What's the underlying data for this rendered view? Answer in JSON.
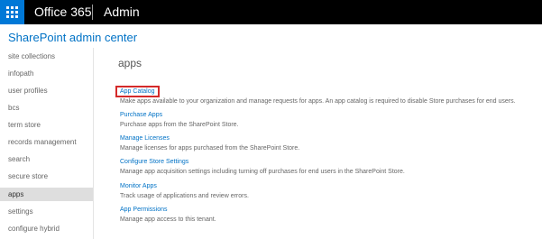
{
  "header": {
    "waffle_icon": "app-launcher-icon",
    "brand": "Office 365",
    "app": "Admin"
  },
  "center_title": "SharePoint admin center",
  "nav": {
    "items": [
      {
        "label": "site collections"
      },
      {
        "label": "infopath"
      },
      {
        "label": "user profiles"
      },
      {
        "label": "bcs"
      },
      {
        "label": "term store"
      },
      {
        "label": "records management"
      },
      {
        "label": "search"
      },
      {
        "label": "secure store"
      },
      {
        "label": "apps",
        "selected": true
      },
      {
        "label": "settings"
      },
      {
        "label": "configure hybrid"
      }
    ]
  },
  "main": {
    "title": "apps",
    "entries": [
      {
        "link": "App Catalog",
        "desc": "Make apps available to your organization and manage requests for apps. An app catalog is required to disable Store purchases for end users.",
        "highlighted": true
      },
      {
        "link": "Purchase Apps",
        "desc": "Purchase apps from the SharePoint Store."
      },
      {
        "link": "Manage Licenses",
        "desc": "Manage licenses for apps purchased from the SharePoint Store."
      },
      {
        "link": "Configure Store Settings",
        "desc": "Manage app acquisition settings including turning off purchases for end users in the SharePoint Store."
      },
      {
        "link": "Monitor Apps",
        "desc": "Track usage of applications and review errors."
      },
      {
        "link": "App Permissions",
        "desc": "Manage app access to this tenant."
      }
    ]
  },
  "colors": {
    "accent": "#0072c6",
    "waffle": "#0078d7",
    "highlight_box": "#d42a2a"
  }
}
